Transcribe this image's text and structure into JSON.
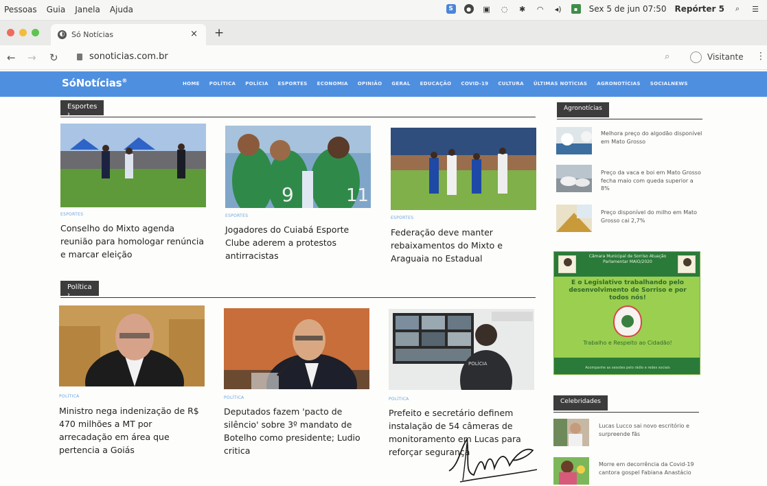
{
  "menubar": {
    "app_menus": [
      "Pessoas",
      "Guia",
      "Janela",
      "Ajuda"
    ],
    "datetime": "Sex 5 de jun 07:50",
    "user": "Repórter 5"
  },
  "browser": {
    "tab_title": "Só Notícias",
    "tab_close": "×",
    "new_tab": "+",
    "url": "sonoticias.com.br",
    "profile_label": "Visitante"
  },
  "site": {
    "logo": "SóNotícias",
    "nav": [
      "HOME",
      "POLÍTICA",
      "POLÍCIA",
      "ESPORTES",
      "ECONOMIA",
      "OPINIÃO",
      "GERAL",
      "EDUCAÇÃO",
      "COVID-19",
      "CULTURA",
      "ÚLTIMAS NOTÍCIAS",
      "AGRONOTÍCIAS",
      "SOCIALNEWS"
    ]
  },
  "sections": {
    "esportes": {
      "label": "Esportes ›",
      "articles": [
        {
          "kicker": "ESPORTES",
          "headline": "Conselho do Mixto agenda reunião para homologar renúncia e marcar eleição"
        },
        {
          "kicker": "ESPORTES",
          "headline": "Jogadores do Cuiabá Esporte Clube aderem a protestos antirracistas"
        },
        {
          "kicker": "ESPORTES",
          "headline": "Federação deve manter rebaixamentos do Mixto e Araguaia no Estadual"
        }
      ]
    },
    "politica": {
      "label": "Política ›",
      "articles": [
        {
          "kicker": "POLÍTICA",
          "headline": "Ministro nega indenização de R$ 470 milhões a MT por arrecadação em área que pertencia a Goiás"
        },
        {
          "kicker": "POLÍTICA",
          "headline": "Deputados fazem 'pacto de silêncio' sobre 3º mandato de Botelho como presidente; Ludio critica"
        },
        {
          "kicker": "POLÍTICA",
          "headline": "Prefeito e secretário definem instalação de 54 câmeras de monitoramento em Lucas para reforçar segurança"
        }
      ]
    }
  },
  "sidebar": {
    "agronoticias": {
      "label": "Agronotícias",
      "items": [
        "Melhora preço do algodão disponível em Mato Grosso",
        "Preço da vaca e boi em Mato Grosso fecha maio com queda superior a 8%",
        "Preço disponível do milho em Mato Grosso cai 2,7%"
      ]
    },
    "ad": {
      "top_text": "Câmara Municipal de Sorriso Atuação Parlamentar MAIO/2020",
      "slogan": "E o Legislativo trabalhando pelo desenvolvimento de Sorriso e por todos nós!",
      "caption": "Trabalho e Respeito ao Cidadão!",
      "bottom_text": "Acompanhe as sessões pelo rádio e redes sociais"
    },
    "celebridades": {
      "label": "Celebridades",
      "items": [
        "Lucas Lucco sai novo escritório e surpreende fãs",
        "Morre em decorrência da Covid-19 cantora gospel Fabiana Anastácio"
      ]
    }
  },
  "colors": {
    "site_nav": "#4f8fe0",
    "section_pill": "#3c3c3c",
    "kicker": "#6aa3e8",
    "ad_green": "#2a7a3a"
  }
}
